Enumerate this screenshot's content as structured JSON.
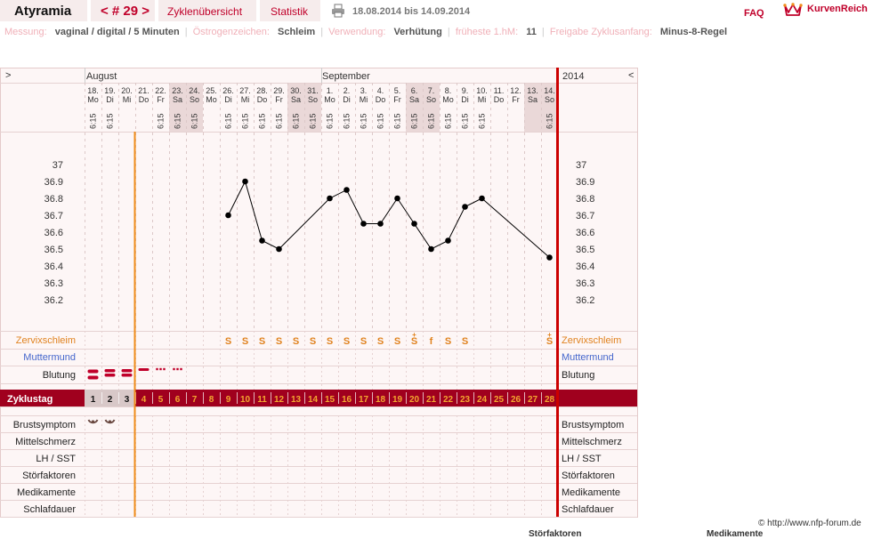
{
  "header": {
    "user": "Atyramia",
    "cycle": "< # 29 >",
    "tab_overview": "Zyklenübersicht",
    "tab_stats": "Statistik",
    "date_range": "18.08.2014 bis 14.09.2014",
    "faq": "FAQ",
    "brand": "KurvenReich"
  },
  "meta": [
    {
      "label": "Messung:",
      "value": "vaginal / digital / 5 Minuten"
    },
    {
      "label": "Östrogenzeichen:",
      "value": "Schleim"
    },
    {
      "label": "Verwendung:",
      "value": "Verhütung"
    },
    {
      "label": "früheste 1.hM:",
      "value": "11"
    },
    {
      "label": "Freigabe Zyklusanfang:",
      "value": "Minus-8-Regel"
    }
  ],
  "nav": {
    "prev": ">",
    "next": "<",
    "year": "2014"
  },
  "months": [
    {
      "label": "August",
      "start_index": 0
    },
    {
      "label": "September",
      "start_index": 14
    }
  ],
  "days": [
    {
      "d": "18.",
      "w": "Mo",
      "t": "6:15",
      "we": false,
      "cd": "1"
    },
    {
      "d": "19.",
      "w": "Di",
      "t": "6:15",
      "we": false,
      "cd": "2"
    },
    {
      "d": "20.",
      "w": "Mi",
      "t": "",
      "we": false,
      "cd": "3"
    },
    {
      "d": "21.",
      "w": "Do",
      "t": "",
      "we": false,
      "cd": "4"
    },
    {
      "d": "22.",
      "w": "Fr",
      "t": "6:15",
      "we": false,
      "cd": "5"
    },
    {
      "d": "23.",
      "w": "Sa",
      "t": "6:15",
      "we": true,
      "cd": "6"
    },
    {
      "d": "24.",
      "w": "So",
      "t": "6:15",
      "we": true,
      "cd": "7"
    },
    {
      "d": "25.",
      "w": "Mo",
      "t": "",
      "we": false,
      "cd": "8"
    },
    {
      "d": "26.",
      "w": "Di",
      "t": "6:15",
      "we": false,
      "cd": "9"
    },
    {
      "d": "27.",
      "w": "Mi",
      "t": "6:15",
      "we": false,
      "cd": "10"
    },
    {
      "d": "28.",
      "w": "Do",
      "t": "6:15",
      "we": false,
      "cd": "11"
    },
    {
      "d": "29.",
      "w": "Fr",
      "t": "6:15",
      "we": false,
      "cd": "12"
    },
    {
      "d": "30.",
      "w": "Sa",
      "t": "6:15",
      "we": true,
      "cd": "13"
    },
    {
      "d": "31.",
      "w": "So",
      "t": "6:15",
      "we": true,
      "cd": "14"
    },
    {
      "d": "1.",
      "w": "Mo",
      "t": "6:15",
      "we": false,
      "cd": "15"
    },
    {
      "d": "2.",
      "w": "Di",
      "t": "6:15",
      "we": false,
      "cd": "16"
    },
    {
      "d": "3.",
      "w": "Mi",
      "t": "6:15",
      "we": false,
      "cd": "17"
    },
    {
      "d": "4.",
      "w": "Do",
      "t": "6:15",
      "we": false,
      "cd": "18"
    },
    {
      "d": "5.",
      "w": "Fr",
      "t": "6:15",
      "we": false,
      "cd": "19"
    },
    {
      "d": "6.",
      "w": "Sa",
      "t": "6:15",
      "we": true,
      "cd": "20"
    },
    {
      "d": "7.",
      "w": "So",
      "t": "6:15",
      "we": true,
      "cd": "21"
    },
    {
      "d": "8.",
      "w": "Mo",
      "t": "6:15",
      "we": false,
      "cd": "22"
    },
    {
      "d": "9.",
      "w": "Di",
      "t": "6:15",
      "we": false,
      "cd": "23"
    },
    {
      "d": "10.",
      "w": "Mi",
      "t": "6:15",
      "we": false,
      "cd": "24"
    },
    {
      "d": "11.",
      "w": "Do",
      "t": "",
      "we": false,
      "cd": "25"
    },
    {
      "d": "12.",
      "w": "Fr",
      "t": "",
      "we": false,
      "cd": "26"
    },
    {
      "d": "13.",
      "w": "Sa",
      "t": "",
      "we": true,
      "cd": "27"
    },
    {
      "d": "14.",
      "w": "So",
      "t": "6:15",
      "we": true,
      "cd": "28"
    }
  ],
  "chart_data": {
    "type": "line",
    "title": "",
    "x_label": "",
    "y_label": "",
    "y_ticks": [
      "37",
      "36.9",
      "36.8",
      "36.7",
      "36.6",
      "36.5",
      "36.4",
      "36.3",
      "36.2"
    ],
    "ylim": [
      36.2,
      37.0
    ],
    "grid": true,
    "series": [
      {
        "values": [
          null,
          null,
          null,
          null,
          null,
          null,
          null,
          null,
          36.7,
          36.9,
          36.55,
          36.5,
          null,
          null,
          36.8,
          36.85,
          36.65,
          36.65,
          36.8,
          36.65,
          36.5,
          36.55,
          36.75,
          36.8,
          null,
          null,
          null,
          36.45
        ]
      }
    ],
    "connect_gaps": true
  },
  "rows": {
    "cervix": {
      "label": "Zervixschleim",
      "color": "#e0821e",
      "values": [
        "",
        "",
        "",
        "",
        "",
        "",
        "",
        "",
        "S",
        "S",
        "S",
        "S",
        "S",
        "S",
        "S",
        "S",
        "S",
        "S",
        "S",
        "S+",
        "f",
        "S",
        "S",
        "",
        "",
        "",
        "",
        "S+"
      ]
    },
    "muttermund": {
      "label": "Muttermund",
      "color": "#4466cc"
    },
    "blutung": {
      "label": "Blutung",
      "values": [
        "heavy",
        "medium",
        "medium",
        "light",
        "spotting",
        "spotting",
        "",
        "",
        "",
        "",
        "",
        "",
        "",
        "",
        "",
        "",
        "",
        "",
        "",
        "",
        "",
        "",
        "",
        "",
        "",
        "",
        "",
        ""
      ]
    },
    "zyklustag": {
      "label": "Zyklustag"
    },
    "bottom": [
      "Brustsymptom",
      "Mittelschmerz",
      "LH / SST",
      "Störfaktoren",
      "Medikamente",
      "Schlafdauer"
    ],
    "brust_marks": [
      true,
      true
    ]
  },
  "footer": {
    "copyright": "© http://www.nfp-forum.de",
    "cut_left": "Störfaktoren",
    "cut_right": "Medikamente"
  },
  "colors": {
    "accent": "#c0002a",
    "bar": "#a0001e",
    "label_muted": "#f0b0b8",
    "weekend": "#ead8d8",
    "cycle_line": "#f08c1a",
    "today_line": "#cc0000"
  }
}
